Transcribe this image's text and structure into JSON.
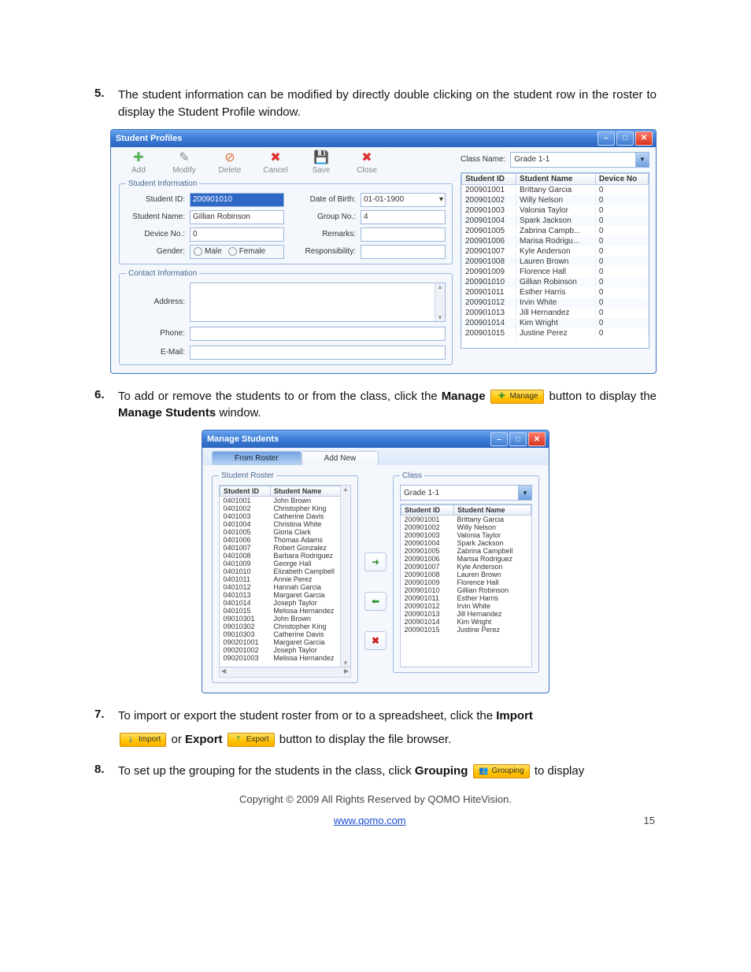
{
  "steps": {
    "s5": {
      "num": "5.",
      "text": "The student information can be modified by directly double clicking on the student row in the roster to display the Student Profile window."
    },
    "s6": {
      "num": "6.",
      "text_a": "To add or remove the students to or from the class, click the ",
      "bold_a": "Manage",
      "text_b": "button to display the ",
      "bold_b": "Manage Students",
      "text_c": " window.",
      "btn_label": "Manage"
    },
    "s7": {
      "num": "7.",
      "text_a": "To import or export the student roster from or to a spreadsheet, click the ",
      "bold_a": "Import",
      "text_b": " or ",
      "bold_b": "Export",
      "text_c": " button to display the file browser.",
      "import_label": "Import",
      "export_label": "Export"
    },
    "s8": {
      "num": "8.",
      "text_a": "To set up the grouping for the students in the class, click ",
      "bold_a": "Grouping",
      "text_b": " to display",
      "btn_label": "Grouping"
    }
  },
  "student_profiles_window": {
    "title": "Student Profiles",
    "toolbar": {
      "add": "Add",
      "modify": "Modify",
      "delete": "Delete",
      "cancel": "Cancel",
      "save": "Save",
      "close": "Close"
    },
    "labels": {
      "student_info_legend": "Student Information",
      "contact_info_legend": "Contact Information",
      "student_id": "Student ID:",
      "student_name": "Student Name:",
      "device_no": "Device No.:",
      "gender": "Gender:",
      "male": "Male",
      "female": "Female",
      "dob": "Date of Birth:",
      "group_no": "Group No.:",
      "remarks": "Remarks:",
      "responsibility": "Responsibility:",
      "address": "Address:",
      "phone": "Phone:",
      "email": "E-Mail:",
      "class_name": "Class Name:"
    },
    "values": {
      "student_id": "200901010",
      "student_name": "Gillian Robinson",
      "device_no": "0",
      "dob": "01-01-1900",
      "group_no": "4",
      "class_name": "Grade 1-1"
    },
    "table_headers": {
      "id": "Student ID",
      "name": "Student Name",
      "dev": "Device No"
    },
    "roster": [
      {
        "id": "200901001",
        "name": "Brittany Garcia",
        "dev": "0"
      },
      {
        "id": "200901002",
        "name": "Willy Nelson",
        "dev": "0"
      },
      {
        "id": "200901003",
        "name": "Valonia Taylor",
        "dev": "0"
      },
      {
        "id": "200901004",
        "name": "Spark Jackson",
        "dev": "0"
      },
      {
        "id": "200901005",
        "name": "Zabrina Campb...",
        "dev": "0"
      },
      {
        "id": "200901006",
        "name": "Marisa Rodrigu...",
        "dev": "0"
      },
      {
        "id": "200901007",
        "name": "Kyle Anderson",
        "dev": "0"
      },
      {
        "id": "200901008",
        "name": "Lauren Brown",
        "dev": "0"
      },
      {
        "id": "200901009",
        "name": "Florence Hall",
        "dev": "0"
      },
      {
        "id": "200901010",
        "name": "Gillian Robinson",
        "dev": "0"
      },
      {
        "id": "200901011",
        "name": "Esther Harris",
        "dev": "0"
      },
      {
        "id": "200901012",
        "name": "Irvin White",
        "dev": "0"
      },
      {
        "id": "200901013",
        "name": "Jill Hernandez",
        "dev": "0"
      },
      {
        "id": "200901014",
        "name": "Kim Wright",
        "dev": "0"
      },
      {
        "id": "200901015",
        "name": "Justine Perez",
        "dev": "0"
      }
    ]
  },
  "manage_students_window": {
    "title": "Manage Students",
    "tabs": {
      "from_roster": "From Roster",
      "add_new": "Add New"
    },
    "roster_legend": "Student Roster",
    "class_legend": "Class",
    "class_name": "Grade 1-1",
    "headers": {
      "id": "Student ID",
      "name": "Student Name"
    },
    "left": [
      {
        "id": "0401001",
        "name": "John Brown"
      },
      {
        "id": "0401002",
        "name": "Christopher King"
      },
      {
        "id": "0401003",
        "name": "Catherine Davis"
      },
      {
        "id": "0401004",
        "name": "Christina White"
      },
      {
        "id": "0401005",
        "name": "Gloria Clark"
      },
      {
        "id": "0401006",
        "name": "Thomas Adams"
      },
      {
        "id": "0401007",
        "name": "Robert Gonzalez"
      },
      {
        "id": "0401008",
        "name": "Barbara Rodriguez"
      },
      {
        "id": "0401009",
        "name": "George Hall"
      },
      {
        "id": "0401010",
        "name": "Elizabeth Campbell"
      },
      {
        "id": "0401011",
        "name": "Annie Perez"
      },
      {
        "id": "0401012",
        "name": "Hannah Garcia"
      },
      {
        "id": "0401013",
        "name": "Margaret Garcia"
      },
      {
        "id": "0401014",
        "name": "Joseph Taylor"
      },
      {
        "id": "0401015",
        "name": "Melissa Hernandez"
      },
      {
        "id": "09010301",
        "name": "John Brown"
      },
      {
        "id": "09010302",
        "name": "Christopher King"
      },
      {
        "id": "09010303",
        "name": "Catherine Davis"
      },
      {
        "id": "090201001",
        "name": "Margaret Garcia"
      },
      {
        "id": "090201002",
        "name": "Joseph Taylor"
      },
      {
        "id": "090201003",
        "name": "Melissa Hernandez"
      }
    ],
    "right": [
      {
        "id": "200901001",
        "name": "Brittany Garcia"
      },
      {
        "id": "200901002",
        "name": "Willy Nelson"
      },
      {
        "id": "200901003",
        "name": "Valonia Taylor"
      },
      {
        "id": "200901004",
        "name": "Spark Jackson"
      },
      {
        "id": "200901005",
        "name": "Zabrina Campbell"
      },
      {
        "id": "200901006",
        "name": "Marisa Rodriguez"
      },
      {
        "id": "200901007",
        "name": "Kyle Anderson"
      },
      {
        "id": "200901008",
        "name": "Lauren Brown"
      },
      {
        "id": "200901009",
        "name": "Florence Hall"
      },
      {
        "id": "200901010",
        "name": "Gillian Robinson"
      },
      {
        "id": "200901011",
        "name": "Esther Harris"
      },
      {
        "id": "200901012",
        "name": "Irvin White"
      },
      {
        "id": "200901013",
        "name": "Jill Hernandez"
      },
      {
        "id": "200901014",
        "name": "Kim Wright"
      },
      {
        "id": "200901015",
        "name": "Justine Perez"
      }
    ]
  },
  "footer": {
    "copyright": "Copyright © 2009 All Rights Reserved by QOMO HiteVision.",
    "url": "www.qomo.com",
    "page": "15"
  }
}
